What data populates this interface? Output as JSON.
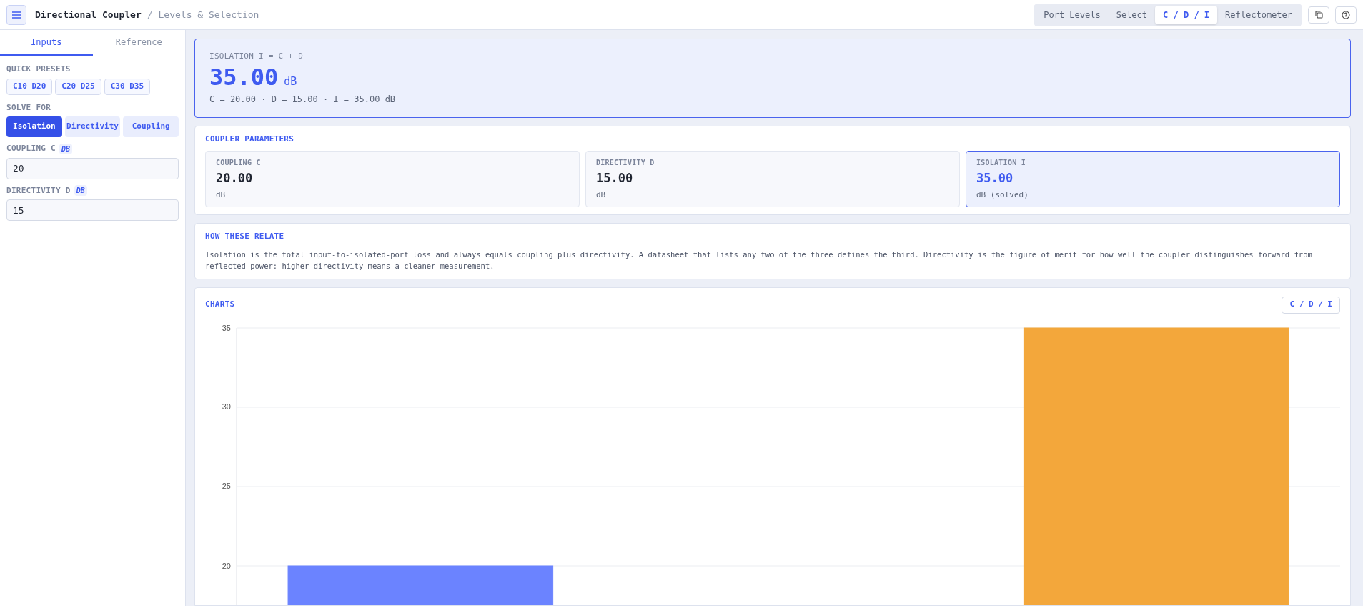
{
  "header": {
    "title": "Directional Coupler",
    "separator": "/",
    "subtitle": "Levels & Selection",
    "nav": [
      {
        "label": "Port Levels",
        "selected": false
      },
      {
        "label": "Select",
        "selected": false
      },
      {
        "label": "C / D / I",
        "selected": true
      },
      {
        "label": "Reflectometer",
        "selected": false
      }
    ]
  },
  "sidebar": {
    "tabs": [
      {
        "label": "Inputs",
        "selected": true
      },
      {
        "label": "Reference",
        "selected": false
      }
    ],
    "presets_label": "QUICK PRESETS",
    "presets": [
      "C10 D20",
      "C20 D25",
      "C30 D35"
    ],
    "solve_label": "SOLVE FOR",
    "solve_options": [
      {
        "label": "Isolation",
        "selected": true
      },
      {
        "label": "Directivity",
        "selected": false
      },
      {
        "label": "Coupling",
        "selected": false
      }
    ],
    "fields": [
      {
        "label": "COUPLING C",
        "unit": "DB",
        "value": "20"
      },
      {
        "label": "DIRECTIVITY D",
        "unit": "DB",
        "value": "15"
      }
    ]
  },
  "result": {
    "label": "ISOLATION I = C + D",
    "value": "35.00",
    "unit": "dB",
    "summary": "C = 20.00 · D = 15.00 · I = 35.00 dB"
  },
  "parameters": {
    "title": "COUPLER PARAMETERS",
    "items": [
      {
        "label": "COUPLING C",
        "value": "20.00",
        "unit": "dB",
        "solved": false
      },
      {
        "label": "DIRECTIVITY D",
        "value": "15.00",
        "unit": "dB",
        "solved": false
      },
      {
        "label": "ISOLATION I",
        "value": "35.00",
        "unit": "dB (solved)",
        "solved": true
      }
    ]
  },
  "explanation": {
    "title": "HOW THESE RELATE",
    "text": "Isolation is the total input-to-isolated-port loss and always equals coupling plus directivity. A datasheet that lists any two of the three defines the third. Directivity is the figure of merit for how well the coupler distinguishes forward from reflected power: higher directivity means a cleaner measurement."
  },
  "charts": {
    "title": "CHARTS",
    "toggle": "C / D / I",
    "chart_data": {
      "type": "bar",
      "grid": true,
      "ylim": [
        17.5,
        35
      ],
      "yticks": [
        20,
        25,
        30,
        35
      ],
      "series": [
        {
          "color": "#6b83ff",
          "values": [
            20,
            null,
            null
          ]
        },
        {
          "color": "#f3a73b",
          "values": [
            null,
            null,
            35
          ]
        }
      ]
    }
  }
}
